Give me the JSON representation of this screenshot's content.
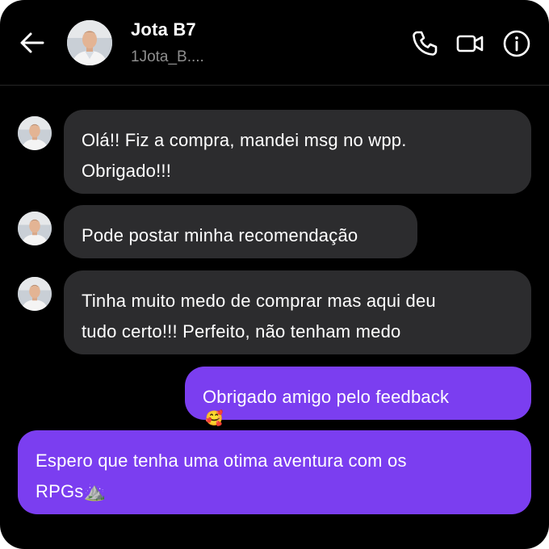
{
  "header": {
    "name": "Jota B7",
    "handle": "1Jota_B....",
    "icons": {
      "back": "arrow-left-icon",
      "call": "phone-icon",
      "video": "video-camera-icon",
      "info": "info-icon"
    }
  },
  "messages": [
    {
      "direction": "incoming",
      "lines": [
        "Olá!! Fiz a compra, mandei msg no wpp.",
        "Obrigado!!!"
      ]
    },
    {
      "direction": "incoming",
      "lines": [
        "Pode postar minha recomendação"
      ]
    },
    {
      "direction": "incoming",
      "lines": [
        "Tinha muito medo de comprar mas aqui deu",
        "tudo certo!!! Perfeito, não tenham medo"
      ]
    },
    {
      "direction": "outgoing",
      "lines": [
        "Obrigado amigo pelo feedback"
      ],
      "reaction": "🥰"
    },
    {
      "direction": "outgoing",
      "lines": [
        "Espero que tenha uma otima aventura com os",
        "RPGs⛰️"
      ]
    }
  ],
  "colors": {
    "background": "#000000",
    "incoming_bubble": "#2c2c2e",
    "outgoing_bubble": "#7b3ef0",
    "text": "#ffffff",
    "secondary_text": "#8e8e8e"
  }
}
